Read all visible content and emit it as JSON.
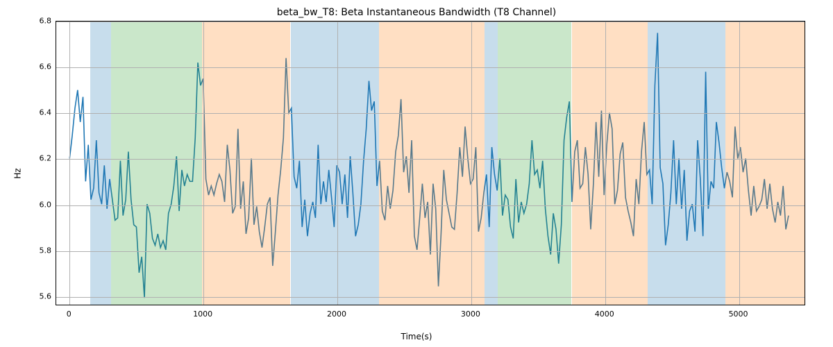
{
  "chart_data": {
    "type": "line",
    "title": "beta_bw_T8: Beta Instantaneous Bandwidth (T8 Channel)",
    "xlabel": "Time(s)",
    "ylabel": "Hz",
    "xlim": [
      -100,
      5500
    ],
    "ylim": [
      5.56,
      6.8
    ],
    "xticks": [
      0,
      1000,
      2000,
      3000,
      4000,
      5000
    ],
    "yticks": [
      5.6,
      5.8,
      6.0,
      6.2,
      6.4,
      6.6,
      6.8
    ],
    "background_spans": [
      {
        "x0": 155,
        "x1": 310,
        "color": "blue"
      },
      {
        "x0": 310,
        "x1": 990,
        "color": "green"
      },
      {
        "x0": 990,
        "x1": 1650,
        "color": "orange"
      },
      {
        "x0": 1650,
        "x1": 2310,
        "color": "blue"
      },
      {
        "x0": 2310,
        "x1": 3100,
        "color": "orange"
      },
      {
        "x0": 3100,
        "x1": 3200,
        "color": "blue"
      },
      {
        "x0": 3200,
        "x1": 3750,
        "color": "green"
      },
      {
        "x0": 3750,
        "x1": 4320,
        "color": "orange"
      },
      {
        "x0": 4320,
        "x1": 4900,
        "color": "blue"
      },
      {
        "x0": 4900,
        "x1": 5500,
        "color": "orange"
      }
    ],
    "series": [
      {
        "name": "beta_bw_T8",
        "color": "#1f77b4",
        "x_step": 20,
        "x_start": 0,
        "values": [
          6.2,
          6.3,
          6.42,
          6.5,
          6.36,
          6.47,
          6.1,
          6.26,
          6.02,
          6.07,
          6.28,
          6.05,
          6.0,
          6.17,
          5.98,
          6.11,
          6.02,
          5.93,
          5.94,
          6.19,
          5.95,
          6.02,
          6.23,
          6.02,
          5.91,
          5.9,
          5.7,
          5.77,
          5.59,
          6.0,
          5.96,
          5.85,
          5.82,
          5.87,
          5.81,
          5.84,
          5.8,
          5.96,
          6.0,
          6.08,
          6.21,
          5.97,
          6.15,
          6.08,
          6.13,
          6.1,
          6.1,
          6.29,
          6.62,
          6.52,
          6.55,
          6.11,
          6.04,
          6.08,
          6.04,
          6.09,
          6.13,
          6.1,
          6.01,
          6.26,
          6.15,
          5.96,
          5.99,
          6.33,
          5.98,
          6.1,
          5.87,
          5.94,
          6.2,
          5.91,
          5.99,
          5.88,
          5.81,
          5.9,
          6.0,
          6.03,
          5.73,
          5.88,
          6.04,
          6.15,
          6.29,
          6.64,
          6.4,
          6.42,
          6.12,
          6.07,
          6.19,
          5.9,
          6.02,
          5.86,
          5.96,
          6.01,
          5.94,
          6.26,
          6.0,
          6.1,
          6.01,
          6.15,
          6.03,
          5.9,
          6.17,
          6.14,
          6.0,
          6.13,
          5.94,
          6.21,
          6.05,
          5.86,
          5.91,
          6.0,
          6.19,
          6.33,
          6.54,
          6.41,
          6.45,
          6.08,
          6.19,
          5.97,
          5.93,
          6.08,
          5.98,
          6.06,
          6.23,
          6.3,
          6.46,
          6.14,
          6.21,
          6.05,
          6.28,
          5.86,
          5.8,
          5.94,
          6.09,
          5.94,
          6.01,
          5.78,
          6.09,
          5.98,
          5.64,
          5.87,
          6.15,
          6.02,
          5.96,
          5.9,
          5.89,
          6.05,
          6.25,
          6.12,
          6.34,
          6.2,
          6.09,
          6.11,
          6.25,
          5.88,
          5.94,
          6.05,
          6.13,
          5.9,
          6.25,
          6.13,
          6.06,
          6.2,
          5.95,
          6.04,
          6.02,
          5.9,
          5.85,
          6.11,
          5.92,
          6.01,
          5.96,
          6.0,
          6.09,
          6.28,
          6.13,
          6.15,
          6.07,
          6.19,
          5.98,
          5.86,
          5.78,
          5.96,
          5.89,
          5.74,
          5.91,
          6.28,
          6.38,
          6.45,
          6.01,
          6.23,
          6.28,
          6.07,
          6.09,
          6.25,
          6.13,
          5.89,
          6.09,
          6.36,
          6.12,
          6.41,
          6.04,
          6.26,
          6.4,
          6.33,
          6.0,
          6.06,
          6.22,
          6.27,
          6.03,
          5.97,
          5.92,
          5.86,
          6.11,
          6.0,
          6.23,
          6.36,
          6.13,
          6.15,
          6.0,
          6.52,
          6.75,
          6.16,
          6.09,
          5.82,
          5.91,
          6.05,
          6.28,
          6.0,
          6.2,
          5.98,
          6.15,
          5.84,
          5.97,
          6.0,
          5.88,
          6.28,
          6.11,
          5.86,
          6.58,
          5.98,
          6.1,
          6.07,
          6.36,
          6.27,
          6.16,
          6.07,
          6.14,
          6.1,
          6.03,
          6.34,
          6.2,
          6.25,
          6.14,
          6.2,
          6.06,
          5.95,
          6.08,
          5.97,
          5.99,
          6.02,
          6.11,
          5.98,
          6.09,
          5.98,
          5.92,
          6.01,
          5.95,
          6.08,
          5.89,
          5.95
        ]
      }
    ]
  }
}
